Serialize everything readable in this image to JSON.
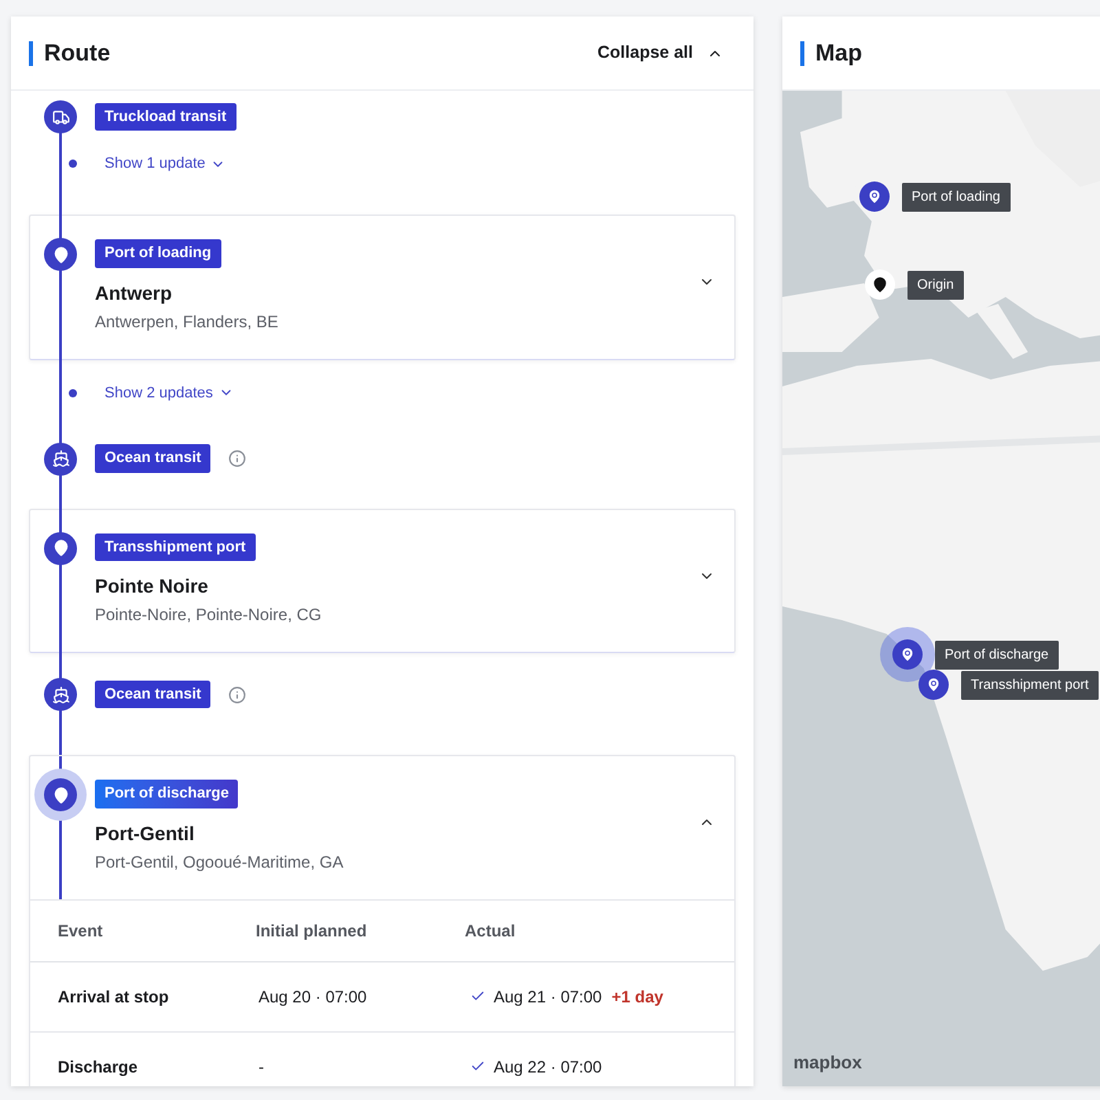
{
  "route": {
    "title": "Route",
    "collapse_all": "Collapse all",
    "items": [
      {
        "kind": "truck_transit",
        "tag": "Truckload transit",
        "info": false
      },
      {
        "kind": "updates",
        "label": "Show 1 update"
      },
      {
        "kind": "stop",
        "tag": "Port of loading",
        "name": "Antwerp",
        "place": "Antwerpen, Flanders, BE",
        "expanded": false,
        "selected": false
      },
      {
        "kind": "updates",
        "label": "Show 2 updates"
      },
      {
        "kind": "ship_transit",
        "tag": "Ocean transit",
        "info": true
      },
      {
        "kind": "stop",
        "tag": "Transshipment port",
        "name": "Pointe Noire",
        "place": "Pointe-Noire, Pointe-Noire, CG",
        "expanded": false,
        "selected": false
      },
      {
        "kind": "ship_transit",
        "tag": "Ocean transit",
        "info": true
      },
      {
        "kind": "stop",
        "tag": "Port of discharge",
        "name": "Port-Gentil",
        "place": "Port-Gentil, Ogooué-Maritime, GA",
        "expanded": true,
        "selected": true,
        "table": {
          "columns": [
            "Event",
            "Initial planned",
            "Actual"
          ],
          "rows": [
            {
              "event": "Arrival at stop",
              "planned": "Aug 20 · 07:00",
              "actual": "Aug 21 · 07:00",
              "done": true,
              "delay": "+1 day"
            },
            {
              "event": "Discharge",
              "planned": "-",
              "actual": "Aug 22 · 07:00",
              "done": true
            }
          ]
        }
      }
    ]
  },
  "map": {
    "title": "Map",
    "attribution": "mapbox",
    "markers": [
      {
        "label": "Port of loading",
        "kind": "port",
        "selected": false
      },
      {
        "label": "Origin",
        "kind": "origin",
        "selected": false
      },
      {
        "label": "Port of discharge",
        "kind": "port",
        "selected": true
      },
      {
        "label": "Transshipment port",
        "kind": "port",
        "selected": false
      }
    ]
  }
}
